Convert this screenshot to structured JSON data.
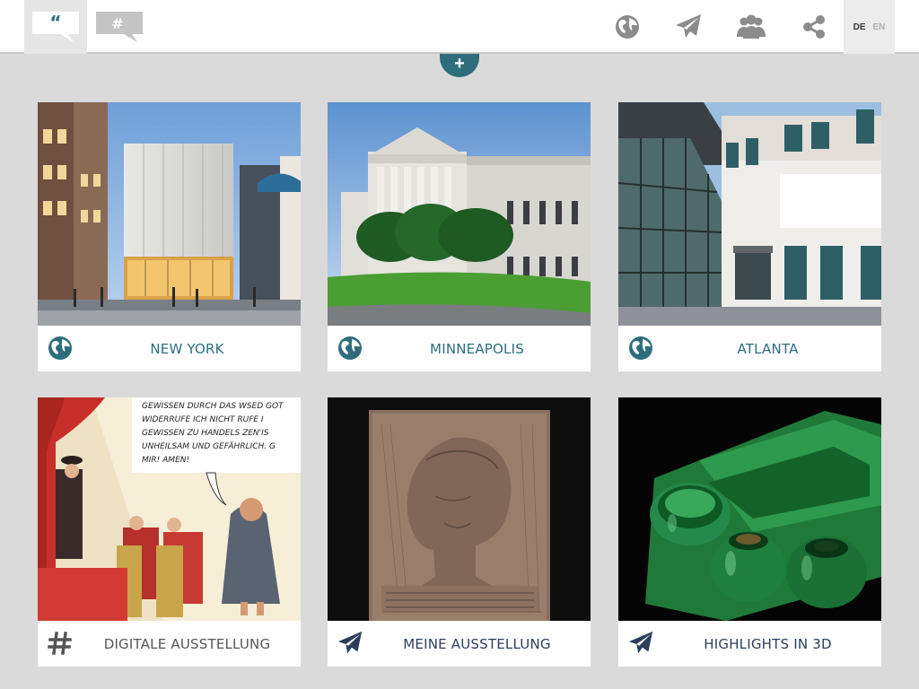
{
  "colors": {
    "accent": "#2e6e7c",
    "navy": "#2b3f5c",
    "icon_gray": "#8c8c8c",
    "background": "#dadada"
  },
  "header": {
    "tabs": [
      {
        "name": "quotes",
        "icon": "quote-bubble-icon",
        "active": true
      },
      {
        "name": "hashtag",
        "icon": "hashtag-bubble-icon",
        "active": false
      }
    ],
    "icons": [
      "globe-icon",
      "paper-plane-icon",
      "users-icon",
      "share-icon"
    ],
    "languages": {
      "de": "DE",
      "en": "EN",
      "selected": "DE"
    },
    "plus_label": "+"
  },
  "cards": [
    {
      "label": "NEW YORK",
      "icon": "globe-icon"
    },
    {
      "label": "MINNEAPOLIS",
      "icon": "globe-icon"
    },
    {
      "label": "ATLANTA",
      "icon": "globe-icon"
    },
    {
      "label": "DIGITALE AUSSTELLUNG",
      "icon": "hashtag-icon"
    },
    {
      "label": "MEINE AUSSTELLUNG",
      "icon": "paper-plane-icon"
    },
    {
      "label": "HIGHLIGHTS IN 3D",
      "icon": "paper-plane-icon"
    }
  ],
  "comic_text": [
    "GEWISSEN DURCH DAS WSED GOT",
    "WIDERRUFE ICH NICHT RUFE I",
    "GEWISSEN ZU HANDELS ZEN'IS",
    "UNHEILSAM UND GEFÄHRLICH. G",
    "MIR! AMEN!"
  ]
}
